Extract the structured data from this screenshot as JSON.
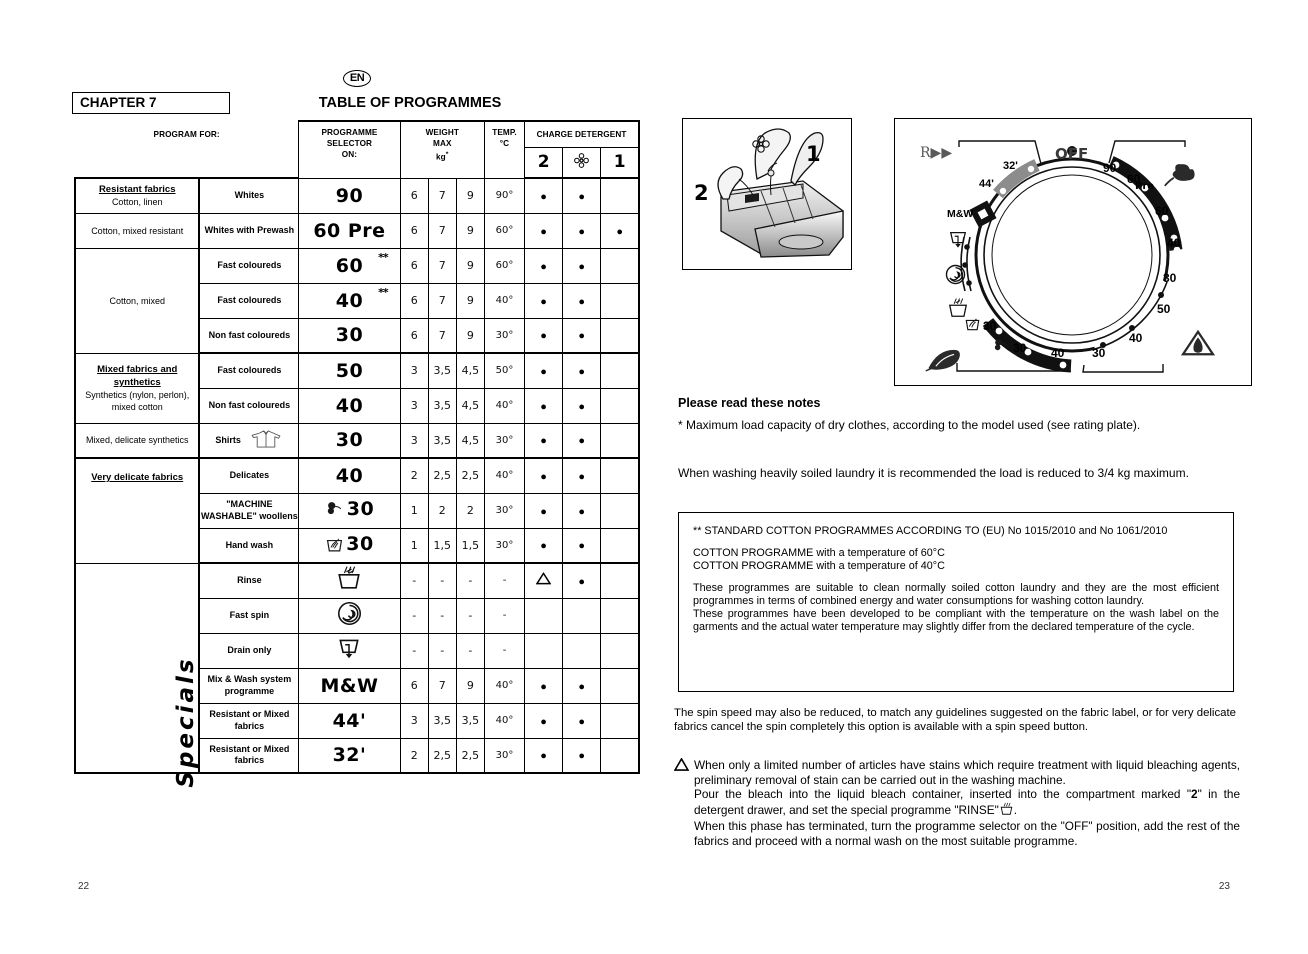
{
  "language_badge": "EN",
  "left_page": {
    "chapter": "CHAPTER 7",
    "title": "TABLE OF PROGRAMMES",
    "page_number": "22",
    "specials_label": "Specials",
    "header": {
      "program_for": "PROGRAM FOR:",
      "selector": "PROGRAMME SELECTOR ON:",
      "selector_l1": "PROGRAMME",
      "selector_l2": "SELECTOR",
      "selector_l3": "ON:",
      "weight_l1": "WEIGHT",
      "weight_l2": "MAX",
      "weight_l3": "kg",
      "weight_star": "*",
      "temp_l1": "TEMP.",
      "temp_l2": "°C",
      "charge_detergent": "CHARGE DETERGENT",
      "det_col_2": "2",
      "det_col_flower": "flower-icon",
      "det_col_1": "1"
    },
    "sections": [
      {
        "name": "resistant",
        "fabric_groups": [
          {
            "title": "Resistant fabrics",
            "sub": "Cotton, linen",
            "rows": 1
          },
          {
            "title": "",
            "sub": "Cotton, mixed resistant",
            "rows": 1
          },
          {
            "title": "",
            "sub": "Cotton, mixed",
            "rows": 3
          }
        ],
        "rows": [
          {
            "program_for": "Whites",
            "selector": "90",
            "stars": "",
            "w1": "6",
            "w2": "7",
            "w3": "9",
            "temp": "90°",
            "d2": true,
            "dflower": true,
            "d1": false
          },
          {
            "program_for": "Whites with Prewash",
            "selector": "60 Pre",
            "stars": "",
            "w1": "6",
            "w2": "7",
            "w3": "9",
            "temp": "60°",
            "d2": true,
            "dflower": true,
            "d1": true
          },
          {
            "program_for": "Fast coloureds",
            "selector": "60",
            "stars": "**",
            "w1": "6",
            "w2": "7",
            "w3": "9",
            "temp": "60°",
            "d2": true,
            "dflower": true,
            "d1": false
          },
          {
            "program_for": "Fast coloureds",
            "selector": "40",
            "stars": "**",
            "w1": "6",
            "w2": "7",
            "w3": "9",
            "temp": "40°",
            "d2": true,
            "dflower": true,
            "d1": false
          },
          {
            "program_for": "Non fast coloureds",
            "selector": "30",
            "stars": "",
            "w1": "6",
            "w2": "7",
            "w3": "9",
            "temp": "30°",
            "d2": true,
            "dflower": true,
            "d1": false
          }
        ]
      },
      {
        "name": "mixed",
        "fabric_groups": [
          {
            "title": "Mixed fabrics and synthetics",
            "sub": "Synthetics (nylon, perlon), mixed cotton",
            "rows": 2
          },
          {
            "title": "",
            "sub": "Mixed, delicate synthetics",
            "rows": 1
          }
        ],
        "rows": [
          {
            "program_for": "Fast coloureds",
            "selector": "50",
            "stars": "",
            "w1": "3",
            "w2": "3,5",
            "w3": "4,5",
            "temp": "50°",
            "d2": true,
            "dflower": true,
            "d1": false
          },
          {
            "program_for": "Non fast coloureds",
            "selector": "40",
            "stars": "",
            "w1": "3",
            "w2": "3,5",
            "w3": "4,5",
            "temp": "40°",
            "d2": true,
            "dflower": true,
            "d1": false
          },
          {
            "program_for": "Shirts",
            "icon": "shirt-icon",
            "selector": "30",
            "stars": "",
            "w1": "3",
            "w2": "3,5",
            "w3": "4,5",
            "temp": "30°",
            "d2": true,
            "dflower": true,
            "d1": false
          }
        ]
      },
      {
        "name": "very-delicate",
        "fabric_groups": [
          {
            "title": "Very delicate fabrics",
            "sub": "",
            "rows": 3
          }
        ],
        "rows": [
          {
            "program_for": "Delicates",
            "selector": "40",
            "stars": "",
            "w1": "2",
            "w2": "2,5",
            "w3": "2,5",
            "temp": "40°",
            "d2": true,
            "dflower": true,
            "d1": false
          },
          {
            "program_for": "\"MACHINE WASHABLE\" woollens",
            "icon": "wool-icon",
            "selector": "30",
            "stars": "",
            "w1": "1",
            "w2": "2",
            "w3": "2",
            "temp": "30°",
            "d2": true,
            "dflower": true,
            "d1": false
          },
          {
            "program_for": "Hand wash",
            "icon": "handwash-icon",
            "selector": "30",
            "stars": "",
            "w1": "1",
            "w2": "1,5",
            "w3": "1,5",
            "temp": "30°",
            "d2": true,
            "dflower": true,
            "d1": false
          }
        ]
      },
      {
        "name": "specials",
        "fabric_groups": [
          {
            "title": "",
            "sub": "",
            "rows": 6
          }
        ],
        "rows": [
          {
            "program_for": "Rinse",
            "selector": "",
            "icon": "rinse-icon",
            "w1": "-",
            "w2": "-",
            "w3": "-",
            "temp": "-",
            "d2": "triangle",
            "dflower": true,
            "d1": false
          },
          {
            "program_for": "Fast spin",
            "selector": "",
            "icon": "spin-icon",
            "w1": "-",
            "w2": "-",
            "w3": "-",
            "temp": "-",
            "d2": false,
            "dflower": false,
            "d1": false
          },
          {
            "program_for": "Drain only",
            "selector": "",
            "icon": "drain-icon",
            "w1": "-",
            "w2": "-",
            "w3": "-",
            "temp": "-",
            "d2": false,
            "dflower": false,
            "d1": false
          },
          {
            "program_for": "Mix & Wash system programme",
            "selector": "M&W",
            "stars": "",
            "w1": "6",
            "w2": "7",
            "w3": "9",
            "temp": "40°",
            "d2": true,
            "dflower": true,
            "d1": false
          },
          {
            "program_for": "Resistant or Mixed fabrics",
            "selector": "44'",
            "stars": "",
            "w1": "3",
            "w2": "3,5",
            "w3": "3,5",
            "temp": "40°",
            "d2": true,
            "dflower": true,
            "d1": false
          },
          {
            "program_for": "Resistant or Mixed fabrics",
            "selector": "32'",
            "stars": "",
            "w1": "2",
            "w2": "2,5",
            "w3": "2,5",
            "temp": "30°",
            "d2": true,
            "dflower": true,
            "d1": false
          }
        ]
      }
    ]
  },
  "right_page": {
    "page_number": "23",
    "drawer": {
      "label_1": "1",
      "label_2": "2"
    },
    "dial": {
      "off": "OFF",
      "rapid": "R",
      "cotton_icon": "cotton-flower-icon",
      "feather_icon": "feather-icon",
      "delicate_triangle_icon": "delicate-triangle-icon",
      "labels_right": [
        "90",
        "60",
        "Pre",
        "60",
        "40",
        "30"
      ],
      "labels_synthetic": [
        "50",
        "40",
        "30"
      ],
      "labels_delicate": [
        "30",
        "30",
        "40"
      ],
      "labels_left": [
        "32'",
        "44'",
        "M&W"
      ],
      "wool_label": "30",
      "handwash_label": "30",
      "delicate_label": "40",
      "drain_icon": "drain-icon",
      "spin_icon": "spin-icon",
      "rinse_icon": "rinse-icon",
      "wool_icon": "wool-icon",
      "handwash_icon": "handwash-icon"
    },
    "notes_heading": "Please read these notes",
    "note_1": "* Maximum load capacity of dry clothes, according to the model used (see rating plate).",
    "note_2": "When washing heavily soiled laundry it is recommended the load is reduced to 3/4 kg maximum.",
    "standard_box": {
      "line_1": "** STANDARD COTTON PROGRAMMES ACCORDING TO (EU) No 1015/2010 and No 1061/2010",
      "line_2": "COTTON PROGRAMME with  a temperature of 60°C",
      "line_3": "COTTON PROGRAMME with a temperature of 40°C",
      "line_4": "These programmes are suitable to clean normally soiled cotton laundry and they are the most efficient programmes in terms of combined energy and water consumptions for washing cotton laundry.",
      "line_5": "These programmes have been developed to be compliant with the temperature on the wash label on the garments and the actual water temperature may slightly differ from the declared temperature of the cycle."
    },
    "spin_note": "The spin speed may also be reduced, to match any guidelines suggested on the fabric label, or for very delicate fabrics cancel the spin completely this option is available with a spin speed button.",
    "bleach_note": {
      "marker": "warning-triangle-icon",
      "para_1": "When only a limited number of articles have stains which require treatment with liquid bleaching agents, preliminary removal of stain can be carried out in the washing machine.",
      "para_2_a": "Pour the bleach into the liquid bleach container, inserted into the compartment marked \"",
      "para_2_b": "2",
      "para_2_c": "\" in the detergent drawer, and set the special programme \"RINSE\"",
      "para_2_d": ".",
      "para_3": "When this phase has terminated, turn the programme selector on the \"OFF\" position, add the rest of the fabrics and proceed with a normal wash on the most suitable programme."
    }
  }
}
